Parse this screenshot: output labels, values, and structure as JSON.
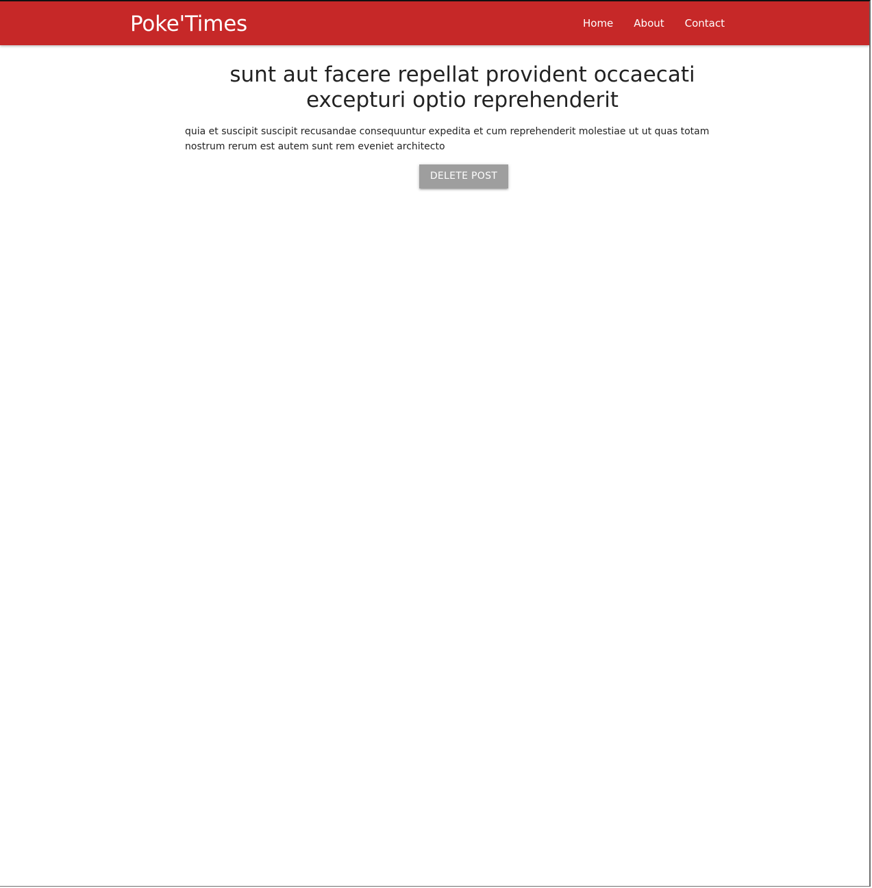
{
  "navbar": {
    "brand": "Poke'Times",
    "color": "#c62828",
    "links": [
      {
        "label": "Home"
      },
      {
        "label": "About"
      },
      {
        "label": "Contact"
      }
    ]
  },
  "post": {
    "title": "sunt aut facere repellat provident occaecati excepturi optio reprehenderit",
    "body": "quia et suscipit suscipit recusandae consequuntur expedita et cum reprehenderit molestiae ut ut quas totam nostrum rerum est autem sunt rem eveniet architecto",
    "delete_label": "DELETE POST",
    "delete_button_color": "#9e9e9e"
  }
}
